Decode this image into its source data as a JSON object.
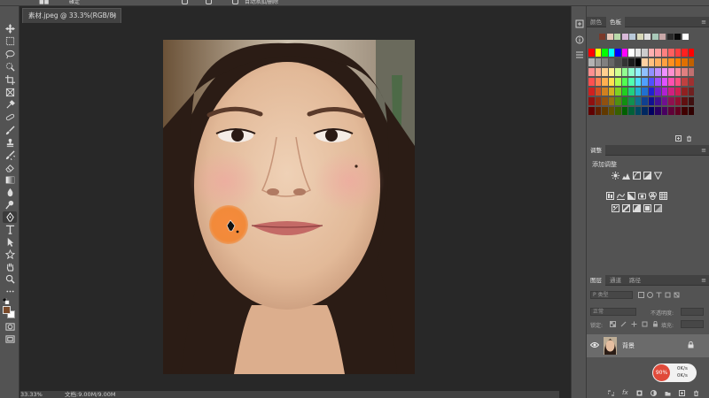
{
  "option_bar": {
    "seg1": "■■",
    "seg2": "確定",
    "seg3": "目动添加/删除"
  },
  "document": {
    "tab_title": "素材.jpeg @ 33.3%(RGB/8) *",
    "close_glyph": "×"
  },
  "status": {
    "zoom": "33.33%",
    "doc_info": "文档:9.00M/9.00M"
  },
  "colors": {
    "foreground": "#7a4a2a",
    "background": "#ffffff",
    "brush_cursor": "#f28a3a"
  },
  "swatches_panel": {
    "tabs": [
      "颜色",
      "色板"
    ],
    "active_tab": "色板",
    "recent_colors": [
      "#7a3a2a",
      "#e8c8b8",
      "#b8d8a8",
      "#d8b8d8",
      "#b8c8d8",
      "#d8d8b8",
      "#e0e0e0",
      "#a8c8b8",
      "#c8a8a8",
      "#2a2a2a",
      "#0a0a0a",
      "#ffffff"
    ],
    "grid_colors": [
      [
        "#ff0000",
        "#ffff00",
        "#00ff00",
        "#00ffff",
        "#0000ff",
        "#ff00ff",
        "#ffffff",
        "#e6e6e6",
        "#cccccc",
        "#ffb0b0",
        "#ffa0a0",
        "#ff8080",
        "#ff6060",
        "#ff4040",
        "#ff2020",
        "#ff0000"
      ],
      [
        "#b3b3b3",
        "#999999",
        "#808080",
        "#666666",
        "#4d4d4d",
        "#333333",
        "#1a1a1a",
        "#000000",
        "#ffd0a0",
        "#ffc080",
        "#ffb060",
        "#ffa040",
        "#ff9020",
        "#ff8000",
        "#e07000",
        "#c06000"
      ],
      [
        "#ff9090",
        "#ffb090",
        "#ffd090",
        "#fff090",
        "#d0ff90",
        "#90ff90",
        "#90ffd0",
        "#90f0ff",
        "#90c0ff",
        "#9090ff",
        "#c090ff",
        "#f090ff",
        "#ff90d0",
        "#ff90a0",
        "#e08080",
        "#c07070"
      ],
      [
        "#ff5050",
        "#ff8050",
        "#ffb050",
        "#ffe050",
        "#b0ff50",
        "#50ff50",
        "#50ffb0",
        "#50e0ff",
        "#50a0ff",
        "#5050ff",
        "#a050ff",
        "#e050ff",
        "#ff50b0",
        "#ff5080",
        "#c04040",
        "#a03030"
      ],
      [
        "#d02020",
        "#d05020",
        "#d08020",
        "#d0b020",
        "#80d020",
        "#20d020",
        "#20d080",
        "#20b0d0",
        "#2070d0",
        "#2020d0",
        "#7020d0",
        "#b020d0",
        "#d02080",
        "#d02050",
        "#902020",
        "#702020"
      ],
      [
        "#901010",
        "#903010",
        "#905010",
        "#907010",
        "#509010",
        "#109010",
        "#109050",
        "#107090",
        "#104090",
        "#101090",
        "#401090",
        "#701090",
        "#901050",
        "#901030",
        "#601010",
        "#401010"
      ],
      [
        "#600000",
        "#602000",
        "#603800",
        "#605000",
        "#386000",
        "#006000",
        "#006038",
        "#004860",
        "#002860",
        "#000060",
        "#280060",
        "#480060",
        "#600038",
        "#600020",
        "#400000",
        "#300000"
      ]
    ]
  },
  "adjustments_panel": {
    "tab": "调整",
    "title": "添加调整"
  },
  "layers_panel": {
    "tabs": [
      "图层",
      "通道",
      "路径"
    ],
    "active_tab": "图层",
    "search_placeholder": "P 类型",
    "blend_mode": "正常",
    "opacity_label": "不透明度:",
    "lock_label": "锁定:",
    "fill_label": "填充:",
    "layers": [
      {
        "name": "背景",
        "locked": true,
        "visible": true
      }
    ]
  },
  "net_widget": {
    "percent": "90%",
    "up": "0K/s",
    "down": "0K/s"
  }
}
